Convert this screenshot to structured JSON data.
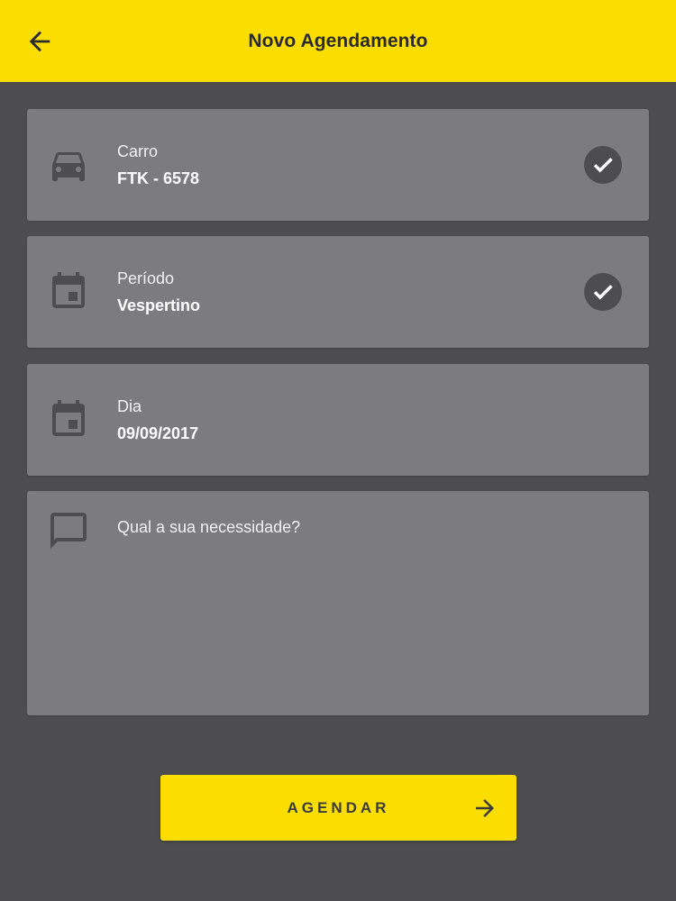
{
  "appbar": {
    "title": "Novo Agendamento",
    "back_icon": "arrow-left-icon"
  },
  "form": {
    "car": {
      "label": "Carro",
      "value": "FTK - 6578",
      "icon": "car-icon",
      "checked": true
    },
    "period": {
      "label": "Período",
      "value": "Vespertino",
      "icon": "calendar-icon",
      "checked": true
    },
    "day": {
      "label": "Dia",
      "value": "09/09/2017",
      "icon": "calendar-icon",
      "checked": false
    },
    "need": {
      "placeholder": "Qual a sua necessidade?",
      "value": "",
      "icon": "comment-icon"
    }
  },
  "submit": {
    "label": "AGENDAR",
    "icon": "arrow-right-icon"
  },
  "colors": {
    "accent": "#fbdd00",
    "background": "#4d4d4f",
    "card": "#7c7c7e",
    "icon": "#4d4d4f"
  }
}
